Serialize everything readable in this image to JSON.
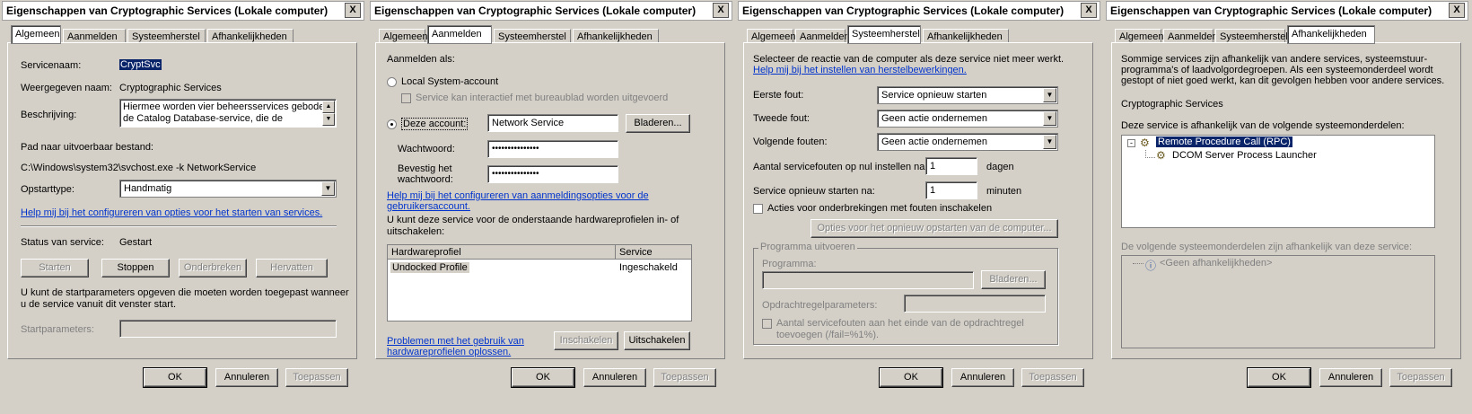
{
  "window_title": "Eigenschappen van Cryptographic Services (Lokale computer)",
  "close_label": "X",
  "tabs": [
    "Algemeen",
    "Aanmelden",
    "Systeemherstel",
    "Afhankelijkheden"
  ],
  "footer": {
    "ok": "OK",
    "cancel": "Annuleren",
    "apply": "Toepassen"
  },
  "general": {
    "service_name_label": "Servicenaam:",
    "service_name": "CryptSvc",
    "display_name_label": "Weergegeven naam:",
    "display_name": "Cryptographic Services",
    "description_label": "Beschrijving:",
    "description_line1": "Hiermee worden vier beheersservices geboden:",
    "description_line2": "de Catalog Database-service, die de",
    "path_label": "Pad naar uitvoerbaar bestand:",
    "path": "C:\\Windows\\system32\\svchost.exe -k NetworkService",
    "startup_type_label": "Opstarttype:",
    "startup_type": "Handmatig",
    "help_link": "Help mij bij het configureren van opties voor het starten van services.",
    "status_label": "Status van service:",
    "status": "Gestart",
    "start_btn": "Starten",
    "stop_btn": "Stoppen",
    "pause_btn": "Onderbreken",
    "resume_btn": "Hervatten",
    "params_note_line1": "U kunt de startparameters opgeven die moeten worden toegepast wanneer",
    "params_note_line2": "u de service vanuit dit venster start.",
    "start_params_label": "Startparameters:",
    "start_params_value": ""
  },
  "logon": {
    "logon_as": "Aanmelden als:",
    "local_system": "Local System-account",
    "interact_desktop": "Service kan interactief met bureaublad worden uitgevoerd",
    "this_account": "Deze account:",
    "account_value": "Network Service",
    "browse_btn": "Bladeren...",
    "password_label": "Wachtwoord:",
    "password_value": "•••••••••••••••",
    "confirm_label_line1": "Bevestig het",
    "confirm_label_line2": "wachtwoord:",
    "confirm_value": "•••••••••••••••",
    "help_link_line1": "Help mij bij het configureren van aanmeldingsopties voor de",
    "help_link_line2": "gebruikersaccount.",
    "hw_note_line1": "U kunt deze service voor de onderstaande hardwareprofielen in- of",
    "hw_note_line2": "uitschakelen:",
    "col_profile": "Hardwareprofiel",
    "col_service": "Service",
    "rows": [
      {
        "profile": "Undocked Profile",
        "service": "Ingeschakeld"
      }
    ],
    "trouble_link_line1": "Problemen met het gebruik van",
    "trouble_link_line2": "hardwareprofielen oplossen.",
    "enable_btn": "Inschakelen",
    "disable_btn": "Uitschakelen"
  },
  "recovery": {
    "intro_line1": "Selecteer de reactie van de computer als deze service niet meer werkt.",
    "help_link": "Help mij bij het instellen van herstelbewerkingen.",
    "first_failure_label": "Eerste fout:",
    "first_failure": "Service opnieuw starten",
    "second_failure_label": "Tweede fout:",
    "second_failure": "Geen actie ondernemen",
    "subsequent_label": "Volgende fouten:",
    "subsequent": "Geen actie ondernemen",
    "reset_label": "Aantal servicefouten op nul instellen na:",
    "reset_value": "1",
    "reset_unit": "dagen",
    "restart_label": "Service opnieuw starten na:",
    "restart_value": "1",
    "restart_unit": "minuten",
    "stop_errors_label": "Acties voor onderbrekingen met fouten inschakelen",
    "restart_options_btn": "Opties voor het opnieuw opstarten van de computer...",
    "run_program_group": "Programma uitvoeren",
    "program_label": "Programma:",
    "browse_btn": "Bladeren...",
    "cmd_params_label": "Opdrachtregelparameters:",
    "append_fail_line1": "Aantal servicefouten aan het einde van de opdrachtregel",
    "append_fail_line2": "toevoegen (/fail=%1%)."
  },
  "dependencies": {
    "intro_line1": "Sommige services zijn afhankelijk van andere services, systeemstuur-",
    "intro_line2": "programma's of laadvolgordegroepen. Als een systeemonderdeel wordt",
    "intro_line3": "gestopt of niet goed werkt, kan dit gevolgen hebben voor andere services.",
    "service": "Cryptographic Services",
    "depends_on_label": "Deze service is afhankelijk van de volgende systeemonderdelen:",
    "tree_root": "Remote Procedure Call (RPC)",
    "tree_child": "DCOM Server Process Launcher",
    "dependents_label": "De volgende systeemonderdelen zijn afhankelijk van deze service:",
    "no_dependents": "<Geen afhankelijkheden>"
  }
}
